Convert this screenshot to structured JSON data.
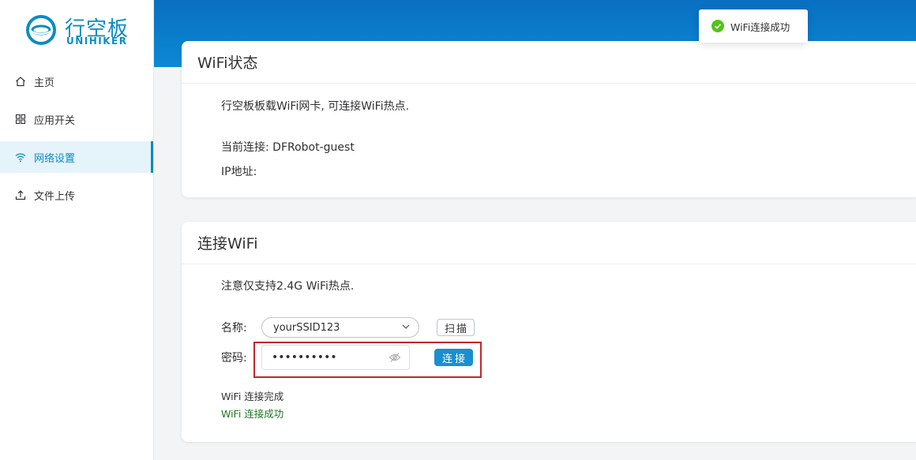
{
  "brand": {
    "name_cn": "行空板",
    "name_en": "UNIHIKER",
    "color": "#0a8cc4"
  },
  "sidebar": {
    "items": [
      {
        "label": "主页",
        "icon": "home-icon"
      },
      {
        "label": "应用开关",
        "icon": "grid-icon"
      },
      {
        "label": "网络设置",
        "icon": "wifi-icon",
        "active": true
      },
      {
        "label": "文件上传",
        "icon": "upload-icon"
      }
    ]
  },
  "toast": {
    "message": "WiFi连接成功",
    "status_color": "#52c41a"
  },
  "status_card": {
    "title": "WiFi状态",
    "description": "行空板板载WiFi网卡, 可连接WiFi热点.",
    "current_connection": "当前连接: DFRobot-guest",
    "ip_label": "IP地址:"
  },
  "connect_card": {
    "title": "连接WiFi",
    "note": "注意仅支持2.4G WiFi热点.",
    "name_label": "名称:",
    "ssid_value": "yourSSID123",
    "scan_label": "扫描",
    "password_label": "密码:",
    "password_value": "••••••••••",
    "connect_label": "连接",
    "log_line_1": "WiFi 连接完成",
    "log_line_2": "WiFi 连接成功",
    "success_color": "#1e7a1e",
    "highlight_color": "#c1272d"
  }
}
